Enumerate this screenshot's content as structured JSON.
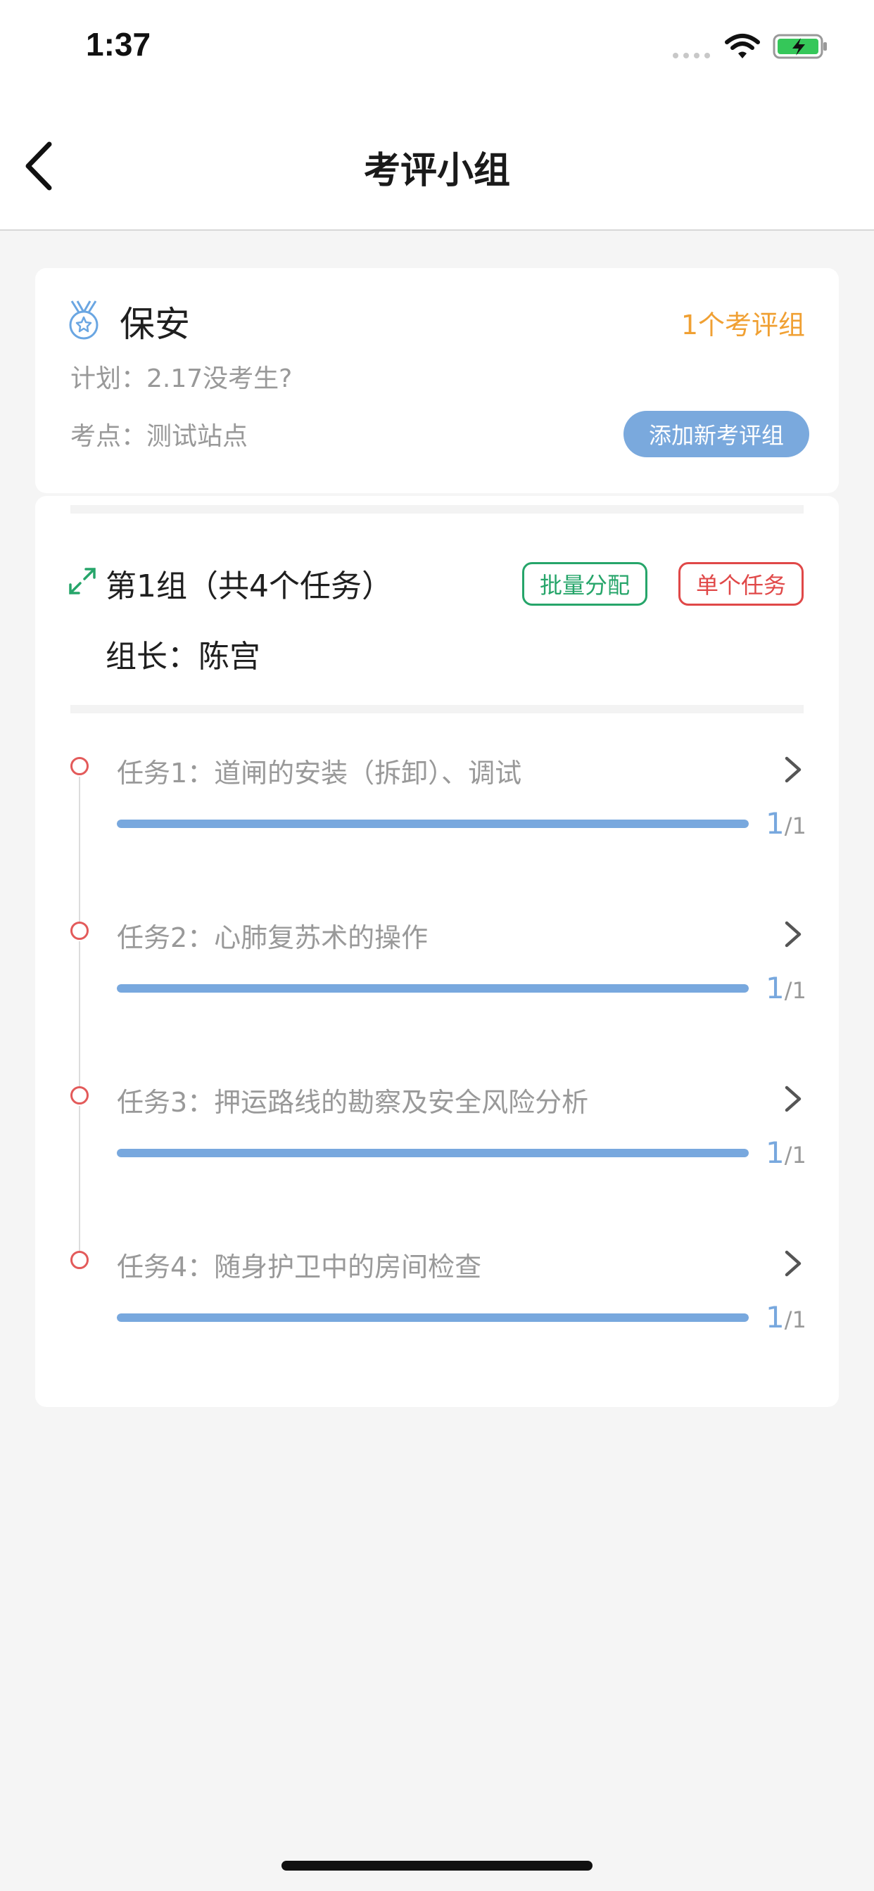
{
  "status_bar": {
    "time": "1:37",
    "signal_icon": "signal-dots-icon",
    "wifi_icon": "wifi-icon",
    "battery_icon": "battery-charging-icon"
  },
  "nav": {
    "title": "考评小组",
    "back_icon": "chevron-left-icon"
  },
  "header": {
    "title": "保安",
    "group_count": "1个考评组",
    "plan": "计划：2.17没考生?",
    "site": "考点：测试站点",
    "add_button": "添加新考评组",
    "icon": "medal-icon"
  },
  "group": {
    "title": "第1组（共4个任务）",
    "leader": "组长：陈宫",
    "batch_button": "批量分配",
    "single_button": "单个任务"
  },
  "tasks": [
    {
      "name": "任务1：道闸的安装（拆卸）、调试",
      "done": "1",
      "slash": "/",
      "total": "1",
      "progress": 1.0
    },
    {
      "name": "任务2：心肺复苏术的操作",
      "done": "1",
      "slash": "/",
      "total": "1",
      "progress": 1.0
    },
    {
      "name": "任务3：押运路线的勘察及安全风险分析",
      "done": "1",
      "slash": "/",
      "total": "1",
      "progress": 1.0
    },
    {
      "name": "任务4：随身护卫中的房间检查",
      "done": "1",
      "slash": "/",
      "total": "1",
      "progress": 1.0
    }
  ],
  "colors": {
    "accent_orange": "#f0a033",
    "progress_blue": "#78a8de",
    "batch_green": "#26a56a",
    "single_red": "#e04848",
    "dot_red": "#e35a5a"
  }
}
